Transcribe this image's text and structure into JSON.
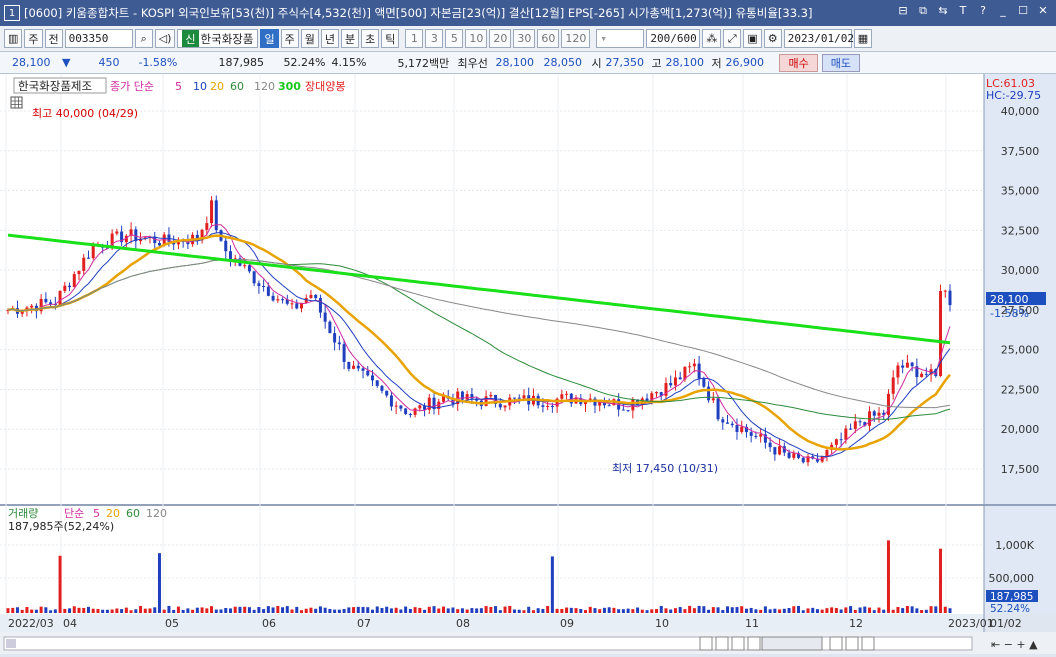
{
  "window": {
    "num": "1",
    "title": "[0600] 키움종합차트 - KOSPI 외국인보유[53(천)] 주식수[4,532(천)] 액면[500] 자본금[23(억)] 결산[12월] EPS[-265] 시가총액[1,273(억)] 유통비율[33.3]"
  },
  "toolbar": {
    "mode1": "주",
    "mode2": "전",
    "code": "003350",
    "badge_new": "신",
    "stock_name": "한국화장품",
    "periods": [
      "일",
      "주",
      "월",
      "년",
      "분",
      "초",
      "틱"
    ],
    "active_period": "일",
    "intervals": [
      "1",
      "3",
      "5",
      "10",
      "20",
      "30",
      "60",
      "120"
    ],
    "count": "200/600",
    "date": "2023/01/02"
  },
  "quote": {
    "price": "28,100",
    "arrow": "▼",
    "change": "450",
    "change_pct": "-1.58%",
    "volume": "187,985",
    "vol_ratio": "52.24%",
    "turnover": "4.15%",
    "amount": "5,172백만",
    "best_label": "최우선",
    "ask": "28,100",
    "bid": "28,050",
    "open_label": "시",
    "open": "27,350",
    "high_label": "고",
    "high": "28,100",
    "low_label": "저",
    "low": "26,900",
    "buy": "매수",
    "sell": "매도"
  },
  "legend": {
    "name": "한국화장품제조",
    "price_label": "종가 단순",
    "ma": [
      "5",
      "10",
      "20",
      "60",
      "120",
      "300"
    ],
    "pattern": "장대양봉"
  },
  "vol_legend": {
    "label": "거래량",
    "ma_label": "단순",
    "ma": [
      "5",
      "20",
      "60",
      "120"
    ],
    "current": "187,985주(52,24%)"
  },
  "labels": {
    "high_note": "최고 40,000 (04/29)",
    "low_note": "최저 17,450 (10/31)",
    "lc": "LC:61.03",
    "hc": "HC:-29.75",
    "last_price": "28,100",
    "last_pct": "-1.58%",
    "vol_last": "187,985",
    "vol_pct": "52.24%"
  },
  "chart_data": {
    "type": "candlestick",
    "y_axis": [
      "40,000",
      "37,500",
      "35,000",
      "32,500",
      "30,000",
      "27,500",
      "25,000",
      "22,500",
      "20,000",
      "17,500"
    ],
    "vol_axis": [
      "1,000K",
      "500,000"
    ],
    "x_ticks": [
      "2022/03",
      "04",
      "05",
      "06",
      "07",
      "08",
      "09",
      "10",
      "11",
      "12",
      "2023/01",
      "01/02"
    ],
    "colors": {
      "up": "#e21f1f",
      "down": "#1f3fbf",
      "ma300": "#19e019",
      "ma20": "#e8a300",
      "ma10": "#1f3fbf",
      "ma5": "#d12c9f",
      "ma60": "#2e8b3a",
      "ma120": "#888888"
    }
  }
}
